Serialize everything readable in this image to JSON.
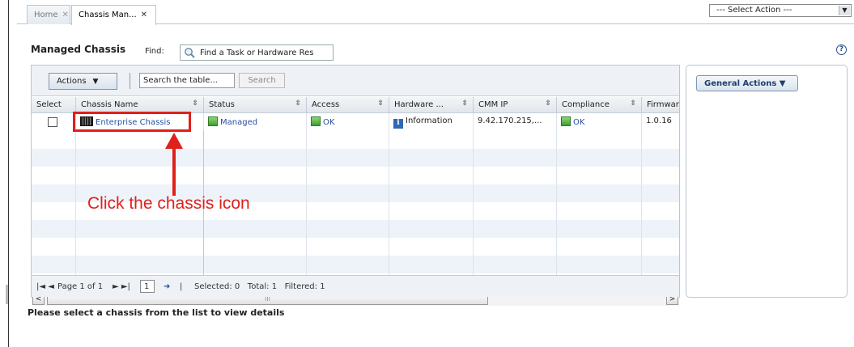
{
  "tabs": [
    {
      "label": "Home",
      "close": "✕"
    },
    {
      "label": "Chassis Man...",
      "close": "✕"
    }
  ],
  "select_action": "--- Select Action ---",
  "page_title": "Managed Chassis",
  "find": {
    "label": "Find:",
    "value": "Find a Task or Hardware Res"
  },
  "toolbar": {
    "actions_label": "Actions",
    "search_placeholder": "Search the table...",
    "search_button": "Search"
  },
  "table": {
    "columns": [
      "Select",
      "Chassis Name",
      "Status",
      "Access",
      "Hardware ...",
      "CMM IP",
      "Compliance",
      "Firmwar"
    ],
    "rows": [
      {
        "chassis_name": "Enterprise Chassis",
        "status": "Managed",
        "access": "OK",
        "hardware": "Information",
        "cmm_ip": "9.42.170.215,...",
        "compliance": "OK",
        "firmware": "1.0.16"
      }
    ]
  },
  "scrollbar": {
    "left": "<",
    "right": ">",
    "grip": "III"
  },
  "pager": {
    "nav_first": "|◄ ◄",
    "page_text": "Page 1 of 1",
    "nav_last": "► ►|",
    "page_value": "1",
    "go": "➜",
    "sep": "|",
    "status": "Selected: 0   Total: 1   Filtered: 1"
  },
  "general_actions": "General Actions",
  "bottom_message": "Please select a chassis from the list to view details",
  "annotation": "Click the chassis icon",
  "help": "?",
  "colors": {
    "accent": "#2650a0",
    "annotation": "#e0201c",
    "status_green": "#3e9e2e"
  }
}
